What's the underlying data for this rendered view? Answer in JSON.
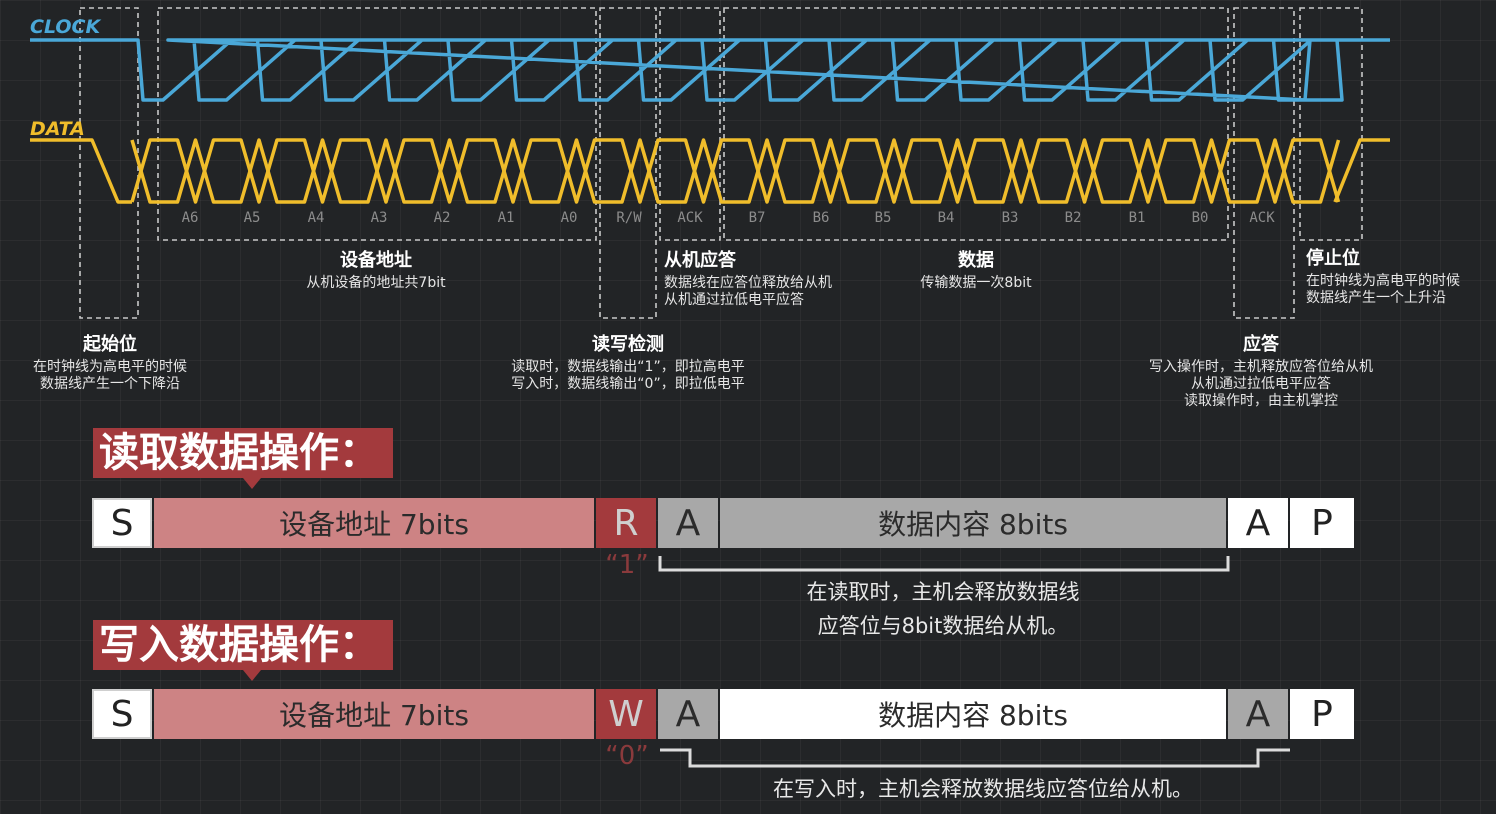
{
  "signals": {
    "clock_label": "CLOCK",
    "data_label": "DATA",
    "clock_color": "#4aa8d8",
    "data_color": "#f0bd2b"
  },
  "bit_labels": [
    "A6",
    "A5",
    "A4",
    "A3",
    "A2",
    "A1",
    "A0",
    "R/W",
    "ACK",
    "B7",
    "B6",
    "B5",
    "B4",
    "B3",
    "B2",
    "B1",
    "B0",
    "ACK"
  ],
  "annotations": {
    "start": {
      "title": "起始位",
      "lines": [
        "在时钟线为高电平的时候",
        "数据线产生一个下降沿"
      ]
    },
    "address": {
      "title": "设备地址",
      "lines": [
        "从机设备的地址共7bit"
      ]
    },
    "rw": {
      "title": "读写检测",
      "lines": [
        "读取时，数据线输出“1”，即拉高电平",
        "写入时，数据线输出“0”，即拉低电平"
      ]
    },
    "slave_ack": {
      "title": "从机应答",
      "lines": [
        "数据线在应答位释放给从机",
        "从机通过拉低电平应答"
      ]
    },
    "data": {
      "title": "数据",
      "lines": [
        "传输数据一次8bit"
      ]
    },
    "ack": {
      "title": "应答",
      "lines": [
        "写入操作时，主机释放应答位给从机",
        "从机通过拉低电平应答",
        "读取操作时，由主机掌控"
      ]
    },
    "stop": {
      "title": "停止位",
      "lines": [
        "在时钟线为高电平的时候",
        "数据线产生一个上升沿"
      ]
    }
  },
  "read_op": {
    "title": "读取数据操作：",
    "cells": [
      "S",
      "设备地址 7bits",
      "R",
      "A",
      "数据内容 8bits",
      "A",
      "P"
    ],
    "bit_value": "“1”",
    "note_lines": [
      "在读取时，主机会释放数据线",
      "应答位与8bit数据给从机。"
    ]
  },
  "write_op": {
    "title": "写入数据操作：",
    "cells": [
      "S",
      "设备地址 7bits",
      "W",
      "A",
      "数据内容 8bits",
      "A",
      "P"
    ],
    "bit_value": "“0”",
    "note_lines": [
      "在写入时，主机会释放数据线应答位给从机。"
    ]
  },
  "colors": {
    "white_cell": "#ffffff",
    "address_cell": "#cd8384",
    "rw_cell": "#a33a3d",
    "grey_cell": "#a8a8a8",
    "title_bg": "#a33a3d"
  }
}
